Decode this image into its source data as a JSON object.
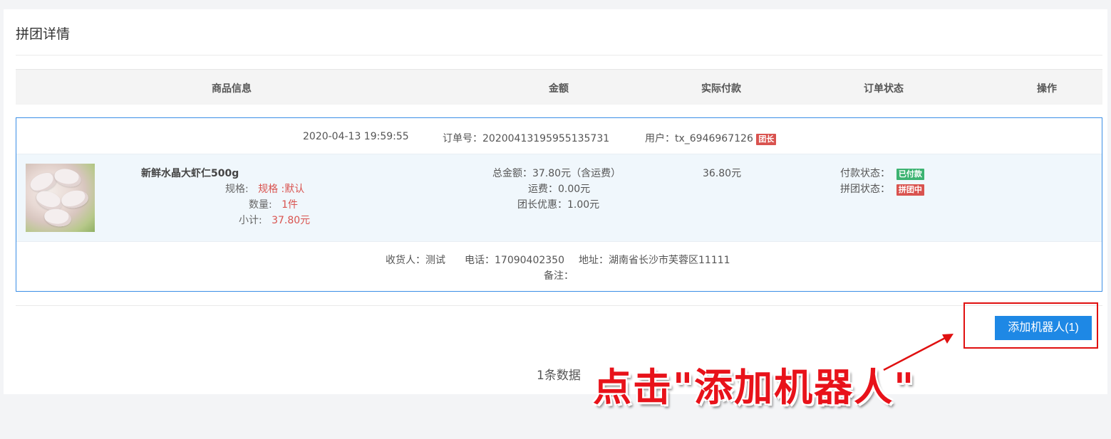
{
  "page_title": "拼团详情",
  "table_headers": {
    "product_info": "商品信息",
    "amount": "金额",
    "actual_payment": "实际付款",
    "order_status": "订单状态",
    "operation": "操作"
  },
  "order": {
    "datetime": "2020-04-13 19:59:55",
    "order_no_label": "订单号：",
    "order_no": "20200413195955135731",
    "user_label": "用户：",
    "user": "tx_6946967126",
    "leader_badge": "团长",
    "product": {
      "name": "新鲜水晶大虾仁500g",
      "spec_label": "规格:",
      "spec_value": "规格 :默认",
      "qty_label": "数量:",
      "qty_value": "1件",
      "subtotal_label": "小计:",
      "subtotal_value": "37.80元"
    },
    "amounts": {
      "total": "总金额：37.80元（含运费）",
      "shipping": "运费：0.00元",
      "leader_discount": "团长优惠：1.00元"
    },
    "actual_paid": "36.80元",
    "status": {
      "payment_label": "付款状态：",
      "payment_badge": "已付款",
      "group_label": "拼团状态：",
      "group_badge": "拼团中"
    },
    "recipient": {
      "receiver": "收货人：测试",
      "phone": "电话：17090402350",
      "address": "地址：湖南省长沙市芙蓉区11111",
      "remark": "备注："
    }
  },
  "add_robot_button": "添加机器人(1)",
  "record_count": "1条数据",
  "annotation_text": "点击\"添加机器人\"",
  "colors": {
    "primary": "#1e88e5",
    "badge_red": "#d9534f",
    "badge_green": "#3cb371",
    "annotation_red": "#e8121a"
  }
}
